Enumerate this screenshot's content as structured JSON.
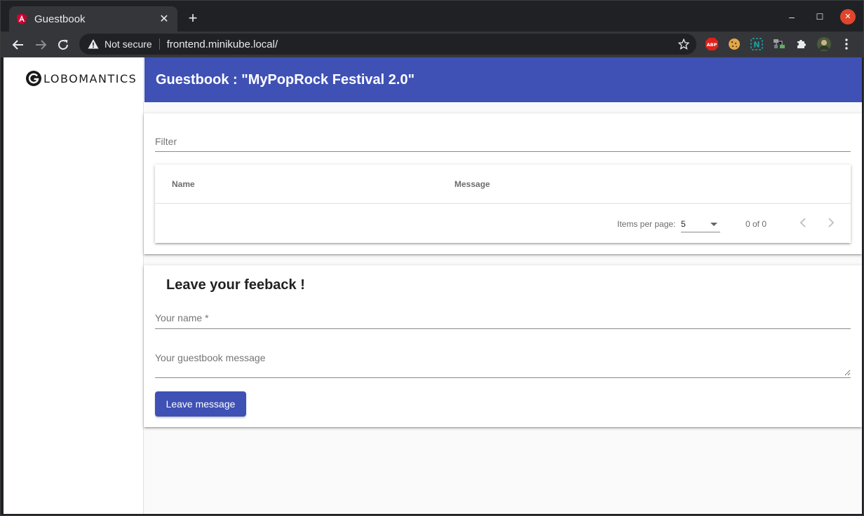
{
  "browser": {
    "tab_title": "Guestbook",
    "tab_close_glyph": "✕",
    "new_tab_glyph": "+",
    "window_controls": {
      "minimize": "–",
      "maximize": "☐",
      "close": "✕"
    },
    "security_label": "Not secure",
    "url": "frontend.minikube.local/",
    "extensions": [
      "adblock-plus-icon",
      "cookie-icon",
      "n-extension-icon",
      "network-extension-icon",
      "puzzle-icon",
      "profile-avatar-icon"
    ],
    "colors": {
      "close_button": "#e0452c",
      "tab_bg": "#35363a"
    }
  },
  "sidebar": {
    "logo_text": "LOBOMANTICS"
  },
  "header": {
    "title": "Guestbook : \"MyPopRock Festival 2.0\"",
    "color": "#3f51b5"
  },
  "list_card": {
    "filter_placeholder": "Filter",
    "columns": [
      "Name",
      "Message"
    ],
    "rows": [],
    "paginator": {
      "items_per_page_label": "Items per page:",
      "page_size": "5",
      "range_label": "0 of 0"
    }
  },
  "form_card": {
    "title": "Leave your feeback !",
    "name_placeholder": "Your name *",
    "message_placeholder": "Your guestbook message",
    "submit_label": "Leave message"
  }
}
